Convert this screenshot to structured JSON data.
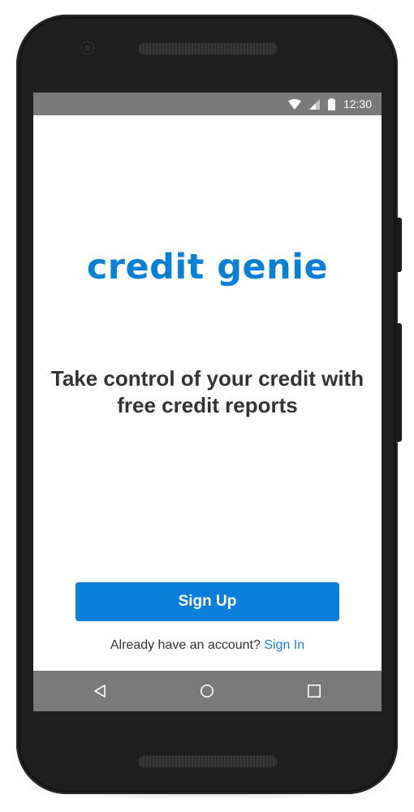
{
  "colors": {
    "brand": "#0b7fd4",
    "button_bg": "#0a7fd9",
    "link": "#1a82d6",
    "bar_gray": "#7a7a7a",
    "phone_frame": "#1e1e1e"
  },
  "status_bar": {
    "time": "12:30",
    "icons": [
      "wifi-icon",
      "cell-signal-icon",
      "battery-icon"
    ]
  },
  "app": {
    "logo": "credit genie",
    "tagline": "Take control of your credit with free credit reports",
    "signup_label": "Sign Up",
    "signin_prompt": "Already have an account?",
    "signin_link": "Sign In"
  },
  "nav_bar": {
    "buttons": [
      "back-icon",
      "home-icon",
      "recents-icon"
    ]
  }
}
